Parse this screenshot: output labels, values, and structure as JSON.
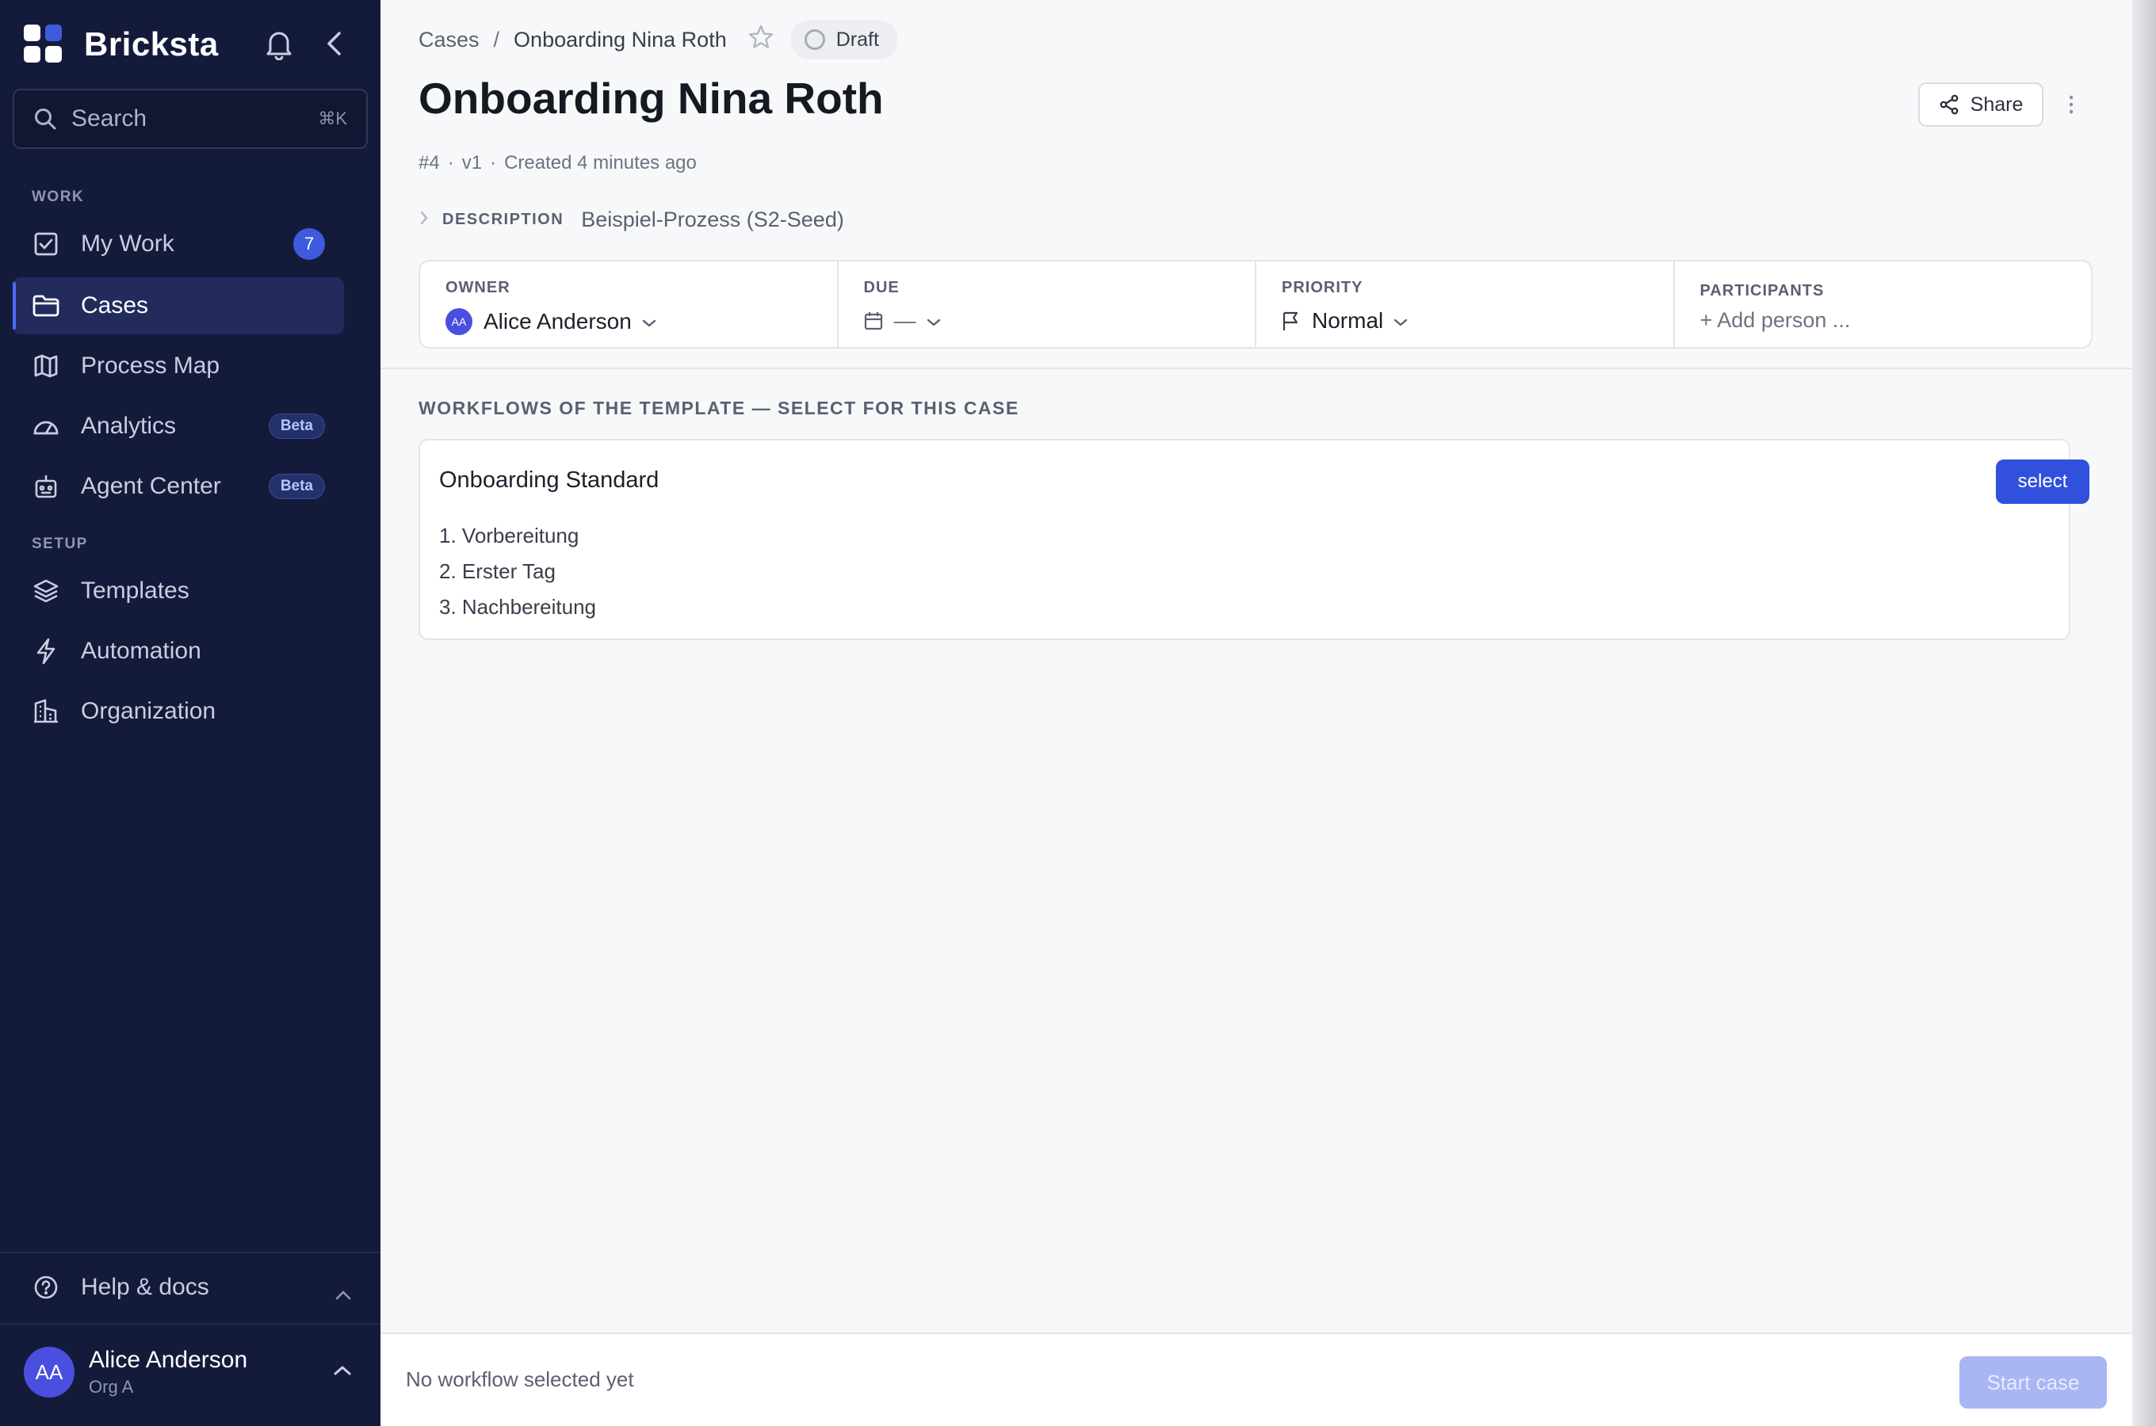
{
  "app": {
    "name": "Bricksta",
    "accent_color": "#3d5bdc",
    "sidebar_bg": "#141a3a"
  },
  "search": {
    "placeholder": "Search",
    "shortcut": "⌘K"
  },
  "sidebar": {
    "sections": [
      {
        "label": "WORK"
      },
      {
        "label": "SETUP"
      }
    ],
    "items": [
      {
        "label": "My Work",
        "icon": "checkbox-icon",
        "badge": "7"
      },
      {
        "label": "Cases",
        "icon": "folder-icon",
        "active": true
      },
      {
        "label": "Process Map",
        "icon": "map-icon"
      },
      {
        "label": "Analytics",
        "icon": "gauge-icon",
        "badge": "Beta"
      },
      {
        "label": "Agent Center",
        "icon": "robot-icon",
        "badge": "Beta"
      },
      {
        "label": "Templates",
        "icon": "layers-icon"
      },
      {
        "label": "Automation",
        "icon": "bolt-icon"
      },
      {
        "label": "Organization",
        "icon": "building-icon"
      }
    ],
    "help_label": "Help & docs",
    "user": {
      "initials": "AA",
      "name": "Alice Anderson",
      "org": "Org A"
    }
  },
  "breadcrumb": {
    "root": "Cases",
    "separator": "/",
    "current": "Onboarding Nina Roth"
  },
  "status": {
    "label": "Draft"
  },
  "case": {
    "title": "Onboarding Nina Roth",
    "number": "#4",
    "version": "v1",
    "created": "Created 4 minutes ago",
    "description_label": "DESCRIPTION",
    "description": "Beispiel-Prozess (S2-Seed)"
  },
  "actions": {
    "share_label": "Share"
  },
  "fields": {
    "owner": {
      "label": "OWNER",
      "initials": "AA",
      "value": "Alice Anderson"
    },
    "due": {
      "label": "DUE",
      "value": "—"
    },
    "priority": {
      "label": "PRIORITY",
      "value": "Normal"
    },
    "participants": {
      "label": "PARTICIPANTS",
      "placeholder": "+ Add person ..."
    }
  },
  "workflows": {
    "heading": "WORKFLOWS OF THE TEMPLATE — SELECT FOR THIS CASE",
    "items": [
      {
        "title": "Onboarding Standard",
        "select_label": "select",
        "steps": [
          "1. Vorbereitung",
          "2. Erster Tag",
          "3. Nachbereitung"
        ]
      }
    ]
  },
  "footer": {
    "status_text": "No workflow selected yet",
    "start_label": "Start case"
  }
}
